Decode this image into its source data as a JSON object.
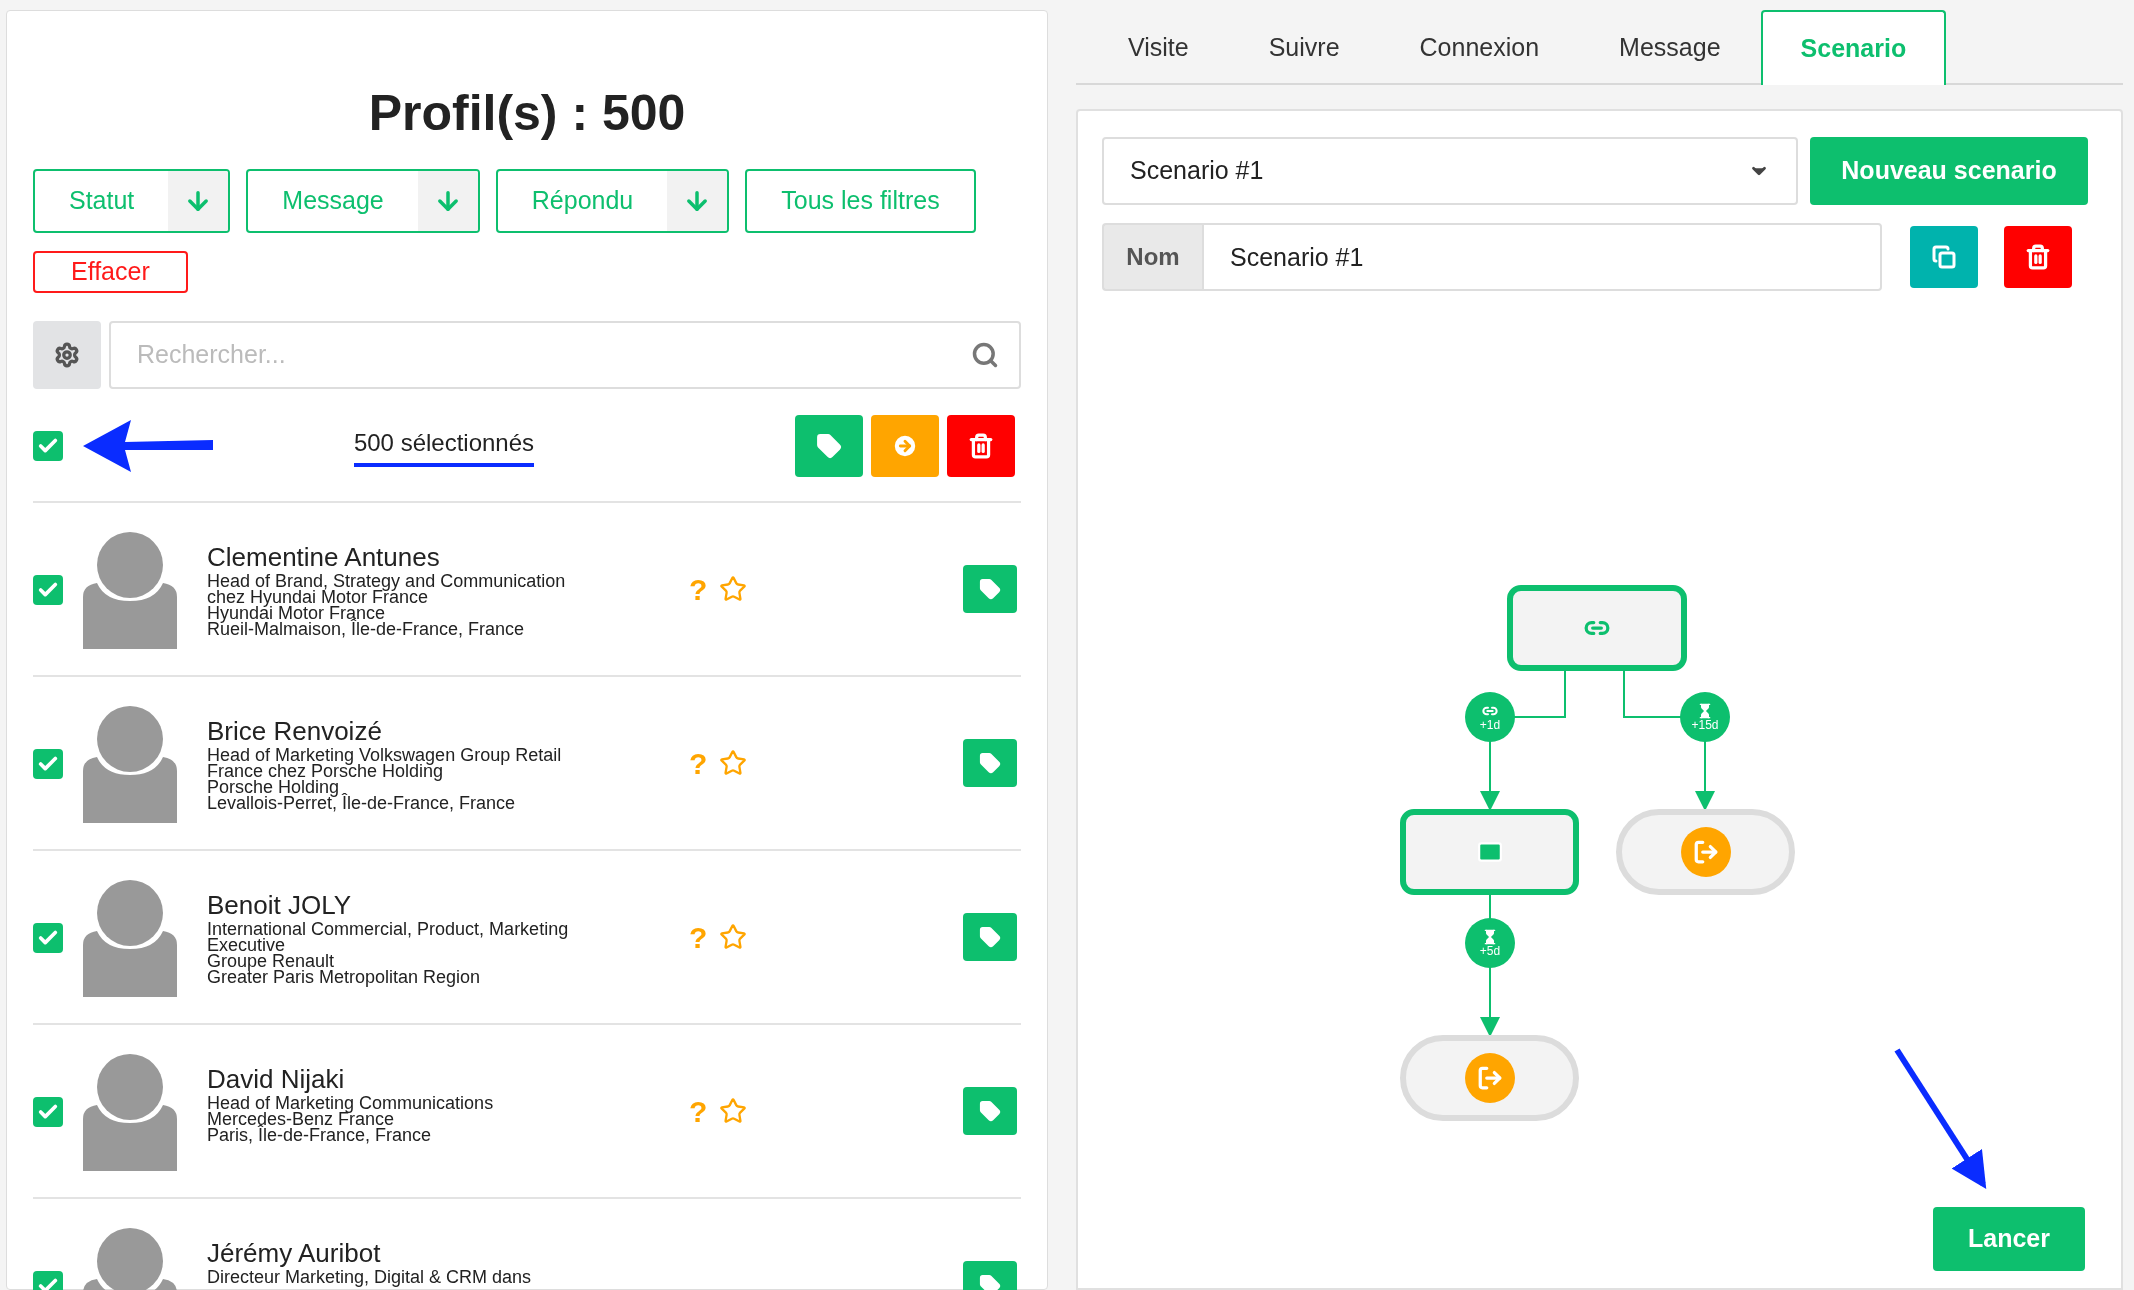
{
  "title": "Profil(s) : 500",
  "filters": [
    {
      "label": "Statut",
      "kind": "dropdown"
    },
    {
      "label": "Message",
      "kind": "dropdown"
    },
    {
      "label": "Répondu",
      "kind": "dropdown"
    },
    {
      "label": "Tous les filtres",
      "kind": "plain"
    }
  ],
  "clear_button": "Effacer",
  "search": {
    "placeholder": "Rechercher..."
  },
  "selection": {
    "checked": true,
    "count_label": "500 sélectionnés"
  },
  "profiles": [
    {
      "name": "Clementine Antunes",
      "lines": [
        "Head of Brand, Strategy and Communication",
        "chez Hyundai Motor France",
        "Hyundai Motor France",
        "Rueil-Malmaison, Île-de-France, France"
      ],
      "checked": true,
      "status": "?",
      "starred": false
    },
    {
      "name": "Brice Renvoizé",
      "lines": [
        "Head of Marketing Volkswagen Group Retail",
        "France chez Porsche Holding",
        "Porsche Holding",
        "Levallois-Perret, Île-de-France, France"
      ],
      "checked": true,
      "status": "?",
      "starred": false
    },
    {
      "name": "Benoit JOLY",
      "lines": [
        "International Commercial, Product, Marketing",
        "Executive",
        "Groupe Renault",
        "Greater Paris Metropolitan Region"
      ],
      "checked": true,
      "status": "?",
      "starred": false
    },
    {
      "name": "David Nijaki",
      "lines": [
        "Head of Marketing Communications",
        "Mercedes-Benz France",
        "Paris, Île-de-France, France"
      ],
      "checked": true,
      "status": "?",
      "starred": false
    },
    {
      "name": "Jérémy Auribot",
      "lines": [
        "Directeur Marketing, Digital & CRM dans"
      ],
      "checked": true
    }
  ],
  "tabs": [
    {
      "label": "Visite",
      "selected": false
    },
    {
      "label": "Suivre",
      "selected": false
    },
    {
      "label": "Connexion",
      "selected": false
    },
    {
      "label": "Message",
      "selected": false
    },
    {
      "label": "Scenario",
      "selected": true
    }
  ],
  "scenario": {
    "dropdown_value": "Scenario #1",
    "new_button": "Nouveau scenario",
    "name_label": "Nom",
    "name_value": "Scenario #1",
    "launch_button": "Lancer"
  },
  "flow": {
    "nodes": [
      {
        "kind": "connect"
      },
      {
        "kind": "message"
      },
      {
        "kind": "end"
      },
      {
        "kind": "end"
      }
    ],
    "delays": [
      {
        "kind": "link",
        "text": "+1d"
      },
      {
        "kind": "wait",
        "text": "+15d"
      },
      {
        "kind": "wait",
        "text": "+5d"
      }
    ]
  }
}
